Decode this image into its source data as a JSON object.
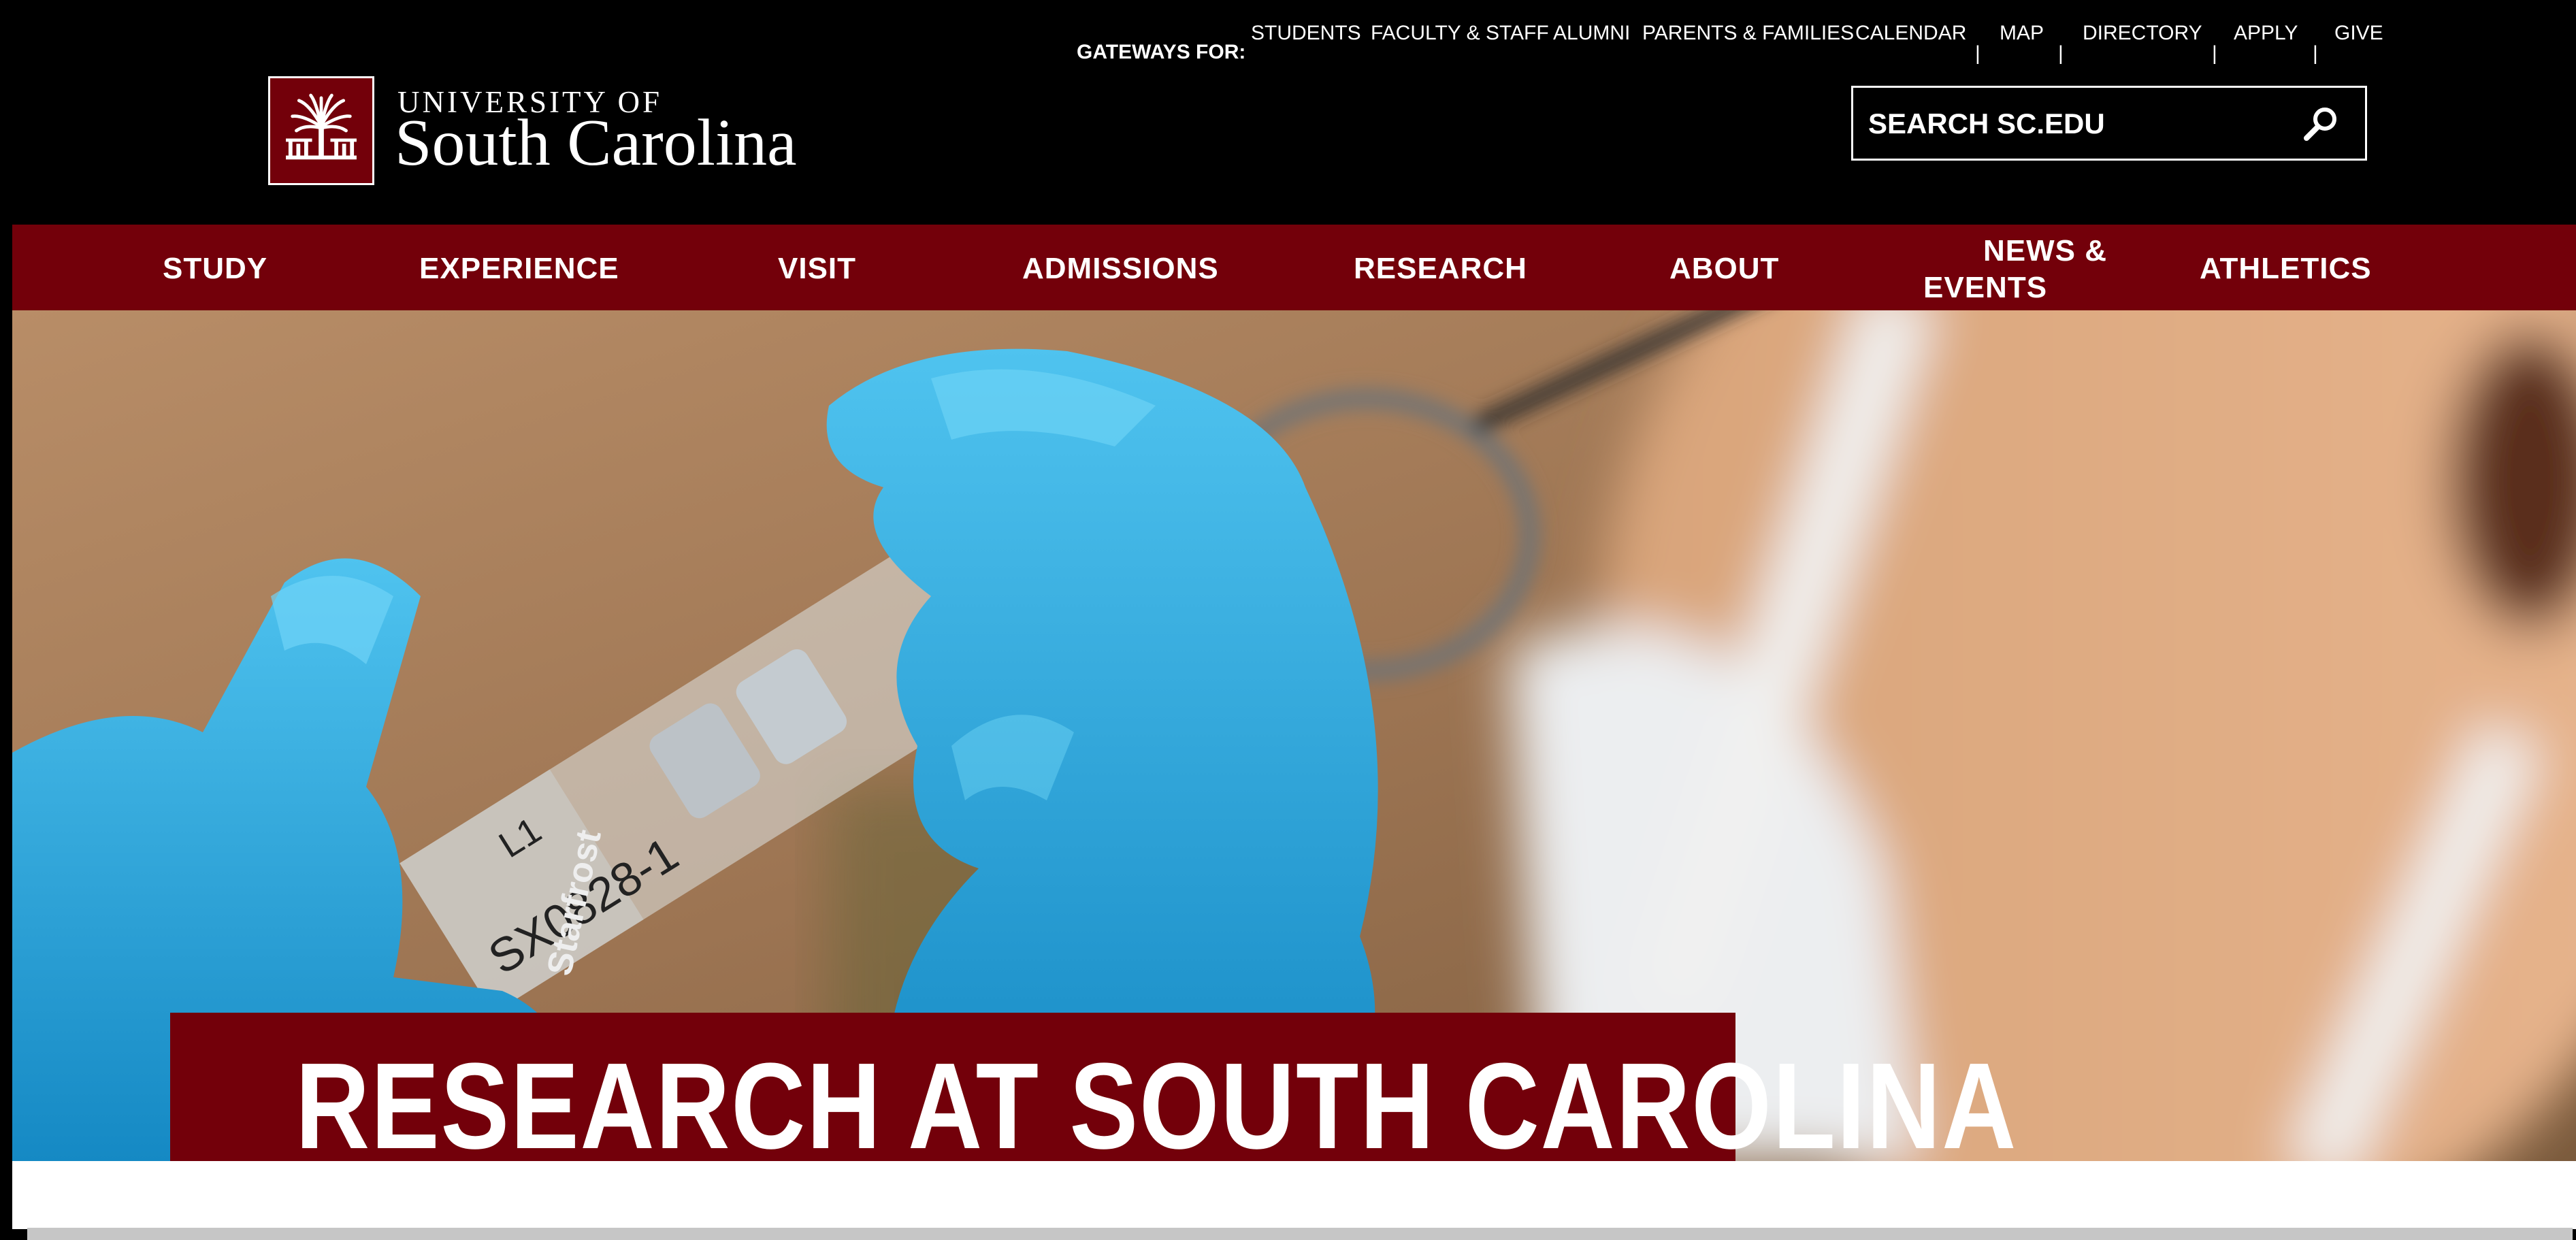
{
  "header": {
    "logo": {
      "line1": "UNIVERSITY OF",
      "line2": "South Carolina"
    },
    "gateways_label": "GATEWAYS FOR:",
    "gateways": [
      {
        "label": "STUDENTS"
      },
      {
        "label": "FACULTY & STAFF"
      },
      {
        "label": "ALUMNI"
      },
      {
        "label": "PARENTS & FAMILIES"
      },
      {
        "label": "CALENDAR"
      },
      {
        "label": "MAP"
      },
      {
        "label": "DIRECTORY"
      },
      {
        "label": "APPLY"
      },
      {
        "label": "GIVE"
      }
    ],
    "search": {
      "placeholder": "SEARCH SC.EDU"
    }
  },
  "nav": {
    "items": [
      {
        "label": "STUDY"
      },
      {
        "label": "EXPERIENCE"
      },
      {
        "label": "VISIT"
      },
      {
        "label": "ADMISSIONS"
      },
      {
        "label": "RESEARCH"
      },
      {
        "label": "ABOUT"
      },
      {
        "label": "NEWS &",
        "label2": "EVENTS"
      },
      {
        "label": "ATHLETICS"
      }
    ]
  },
  "hero": {
    "title": "RESEARCH AT SOUTH CAROLINA",
    "slide_text": {
      "number": "L1",
      "brand": "Starfrost",
      "code": "SX0828-1"
    }
  },
  "colors": {
    "garnet": "#73000a",
    "black": "#000000",
    "white": "#ffffff",
    "glove_blue": "#1fa3dc"
  }
}
